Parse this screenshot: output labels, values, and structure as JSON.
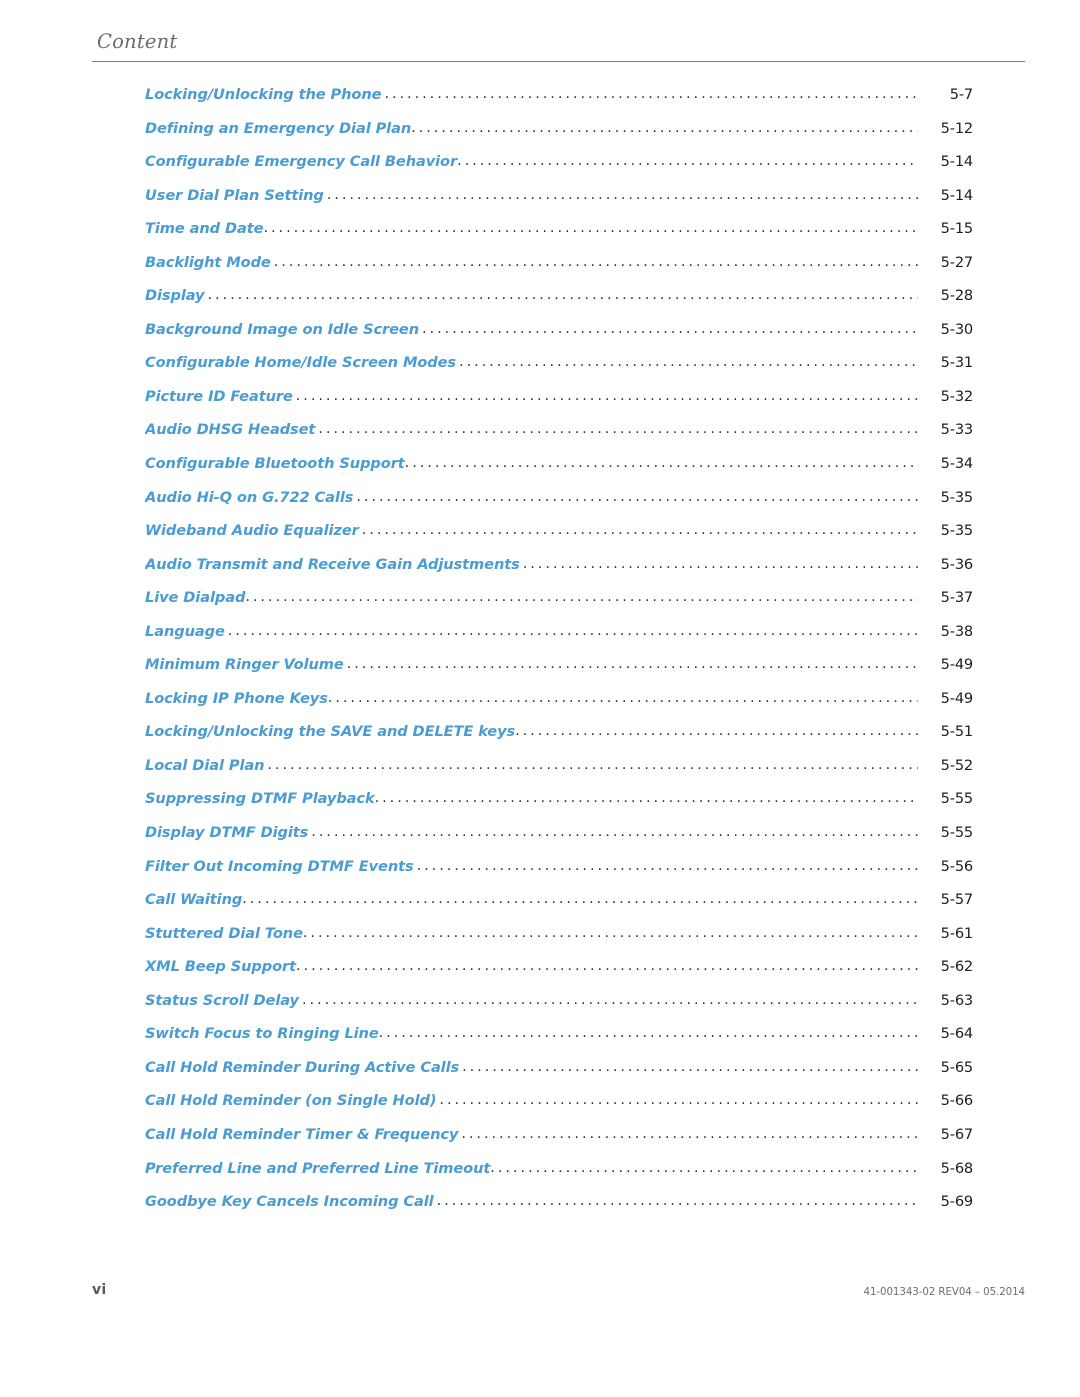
{
  "header": {
    "title": "Content"
  },
  "toc": {
    "entries": [
      {
        "title": "Locking/Unlocking the Phone",
        "page": "5-7",
        "tight": false
      },
      {
        "title": "Defining an Emergency Dial Plan",
        "page": "5-12",
        "tight": true
      },
      {
        "title": "Configurable Emergency Call Behavior",
        "page": "5-14",
        "tight": true
      },
      {
        "title": "User Dial Plan Setting",
        "page": "5-14",
        "tight": false
      },
      {
        "title": "Time and Date",
        "page": "5-15",
        "tight": true
      },
      {
        "title": "Backlight Mode",
        "page": "5-27",
        "tight": false
      },
      {
        "title": "Display",
        "page": "5-28",
        "tight": false
      },
      {
        "title": "Background Image on Idle Screen",
        "page": "5-30",
        "tight": false
      },
      {
        "title": "Configurable Home/Idle Screen Modes",
        "page": "5-31",
        "tight": false
      },
      {
        "title": "Picture ID Feature",
        "page": "5-32",
        "tight": false
      },
      {
        "title": "Audio DHSG Headset",
        "page": "5-33",
        "tight": false
      },
      {
        "title": "Configurable Bluetooth Support",
        "page": "5-34",
        "tight": true
      },
      {
        "title": "Audio Hi-Q on G.722 Calls",
        "page": "5-35",
        "tight": false
      },
      {
        "title": "Wideband Audio Equalizer",
        "page": "5-35",
        "tight": false
      },
      {
        "title": "Audio Transmit and Receive Gain Adjustments",
        "page": "5-36",
        "tight": false
      },
      {
        "title": "Live Dialpad",
        "page": "5-37",
        "tight": true
      },
      {
        "title": "Language",
        "page": "5-38",
        "tight": false
      },
      {
        "title": "Minimum Ringer Volume",
        "page": "5-49",
        "tight": false
      },
      {
        "title": "Locking IP Phone Keys",
        "page": "5-49",
        "tight": true
      },
      {
        "title": "Locking/Unlocking the SAVE and DELETE keys",
        "page": "5-51",
        "tight": true
      },
      {
        "title": "Local Dial Plan",
        "page": "5-52",
        "tight": false
      },
      {
        "title": "Suppressing DTMF Playback",
        "page": "5-55",
        "tight": true
      },
      {
        "title": "Display DTMF Digits",
        "page": "5-55",
        "tight": false
      },
      {
        "title": "Filter Out Incoming DTMF Events",
        "page": "5-56",
        "tight": false
      },
      {
        "title": "Call Waiting",
        "page": "5-57",
        "tight": true
      },
      {
        "title": "Stuttered Dial Tone",
        "page": "5-61",
        "tight": true
      },
      {
        "title": "XML Beep Support",
        "page": "5-62",
        "tight": true
      },
      {
        "title": "Status Scroll Delay",
        "page": "5-63",
        "tight": false
      },
      {
        "title": "Switch Focus to Ringing Line",
        "page": "5-64",
        "tight": true
      },
      {
        "title": "Call Hold Reminder During Active Calls",
        "page": "5-65",
        "tight": false
      },
      {
        "title": "Call Hold Reminder (on Single Hold)",
        "page": "5-66",
        "tight": false
      },
      {
        "title": "Call Hold Reminder Timer & Frequency",
        "page": "5-67",
        "tight": false
      },
      {
        "title": "Preferred Line and Preferred Line Timeout",
        "page": "5-68",
        "tight": true
      },
      {
        "title": "Goodbye Key Cancels Incoming Call",
        "page": "5-69",
        "tight": false
      }
    ]
  },
  "footer": {
    "folio": "vi",
    "doc_id": "41-001343-02 REV04 – 05.2014"
  },
  "colors": {
    "entry_link": "#4a9cd2",
    "header_text": "#6b6b6b",
    "rule": "#7c7c7c",
    "page_number": "#1d1d1d",
    "footer_text": "#6d6e70"
  }
}
